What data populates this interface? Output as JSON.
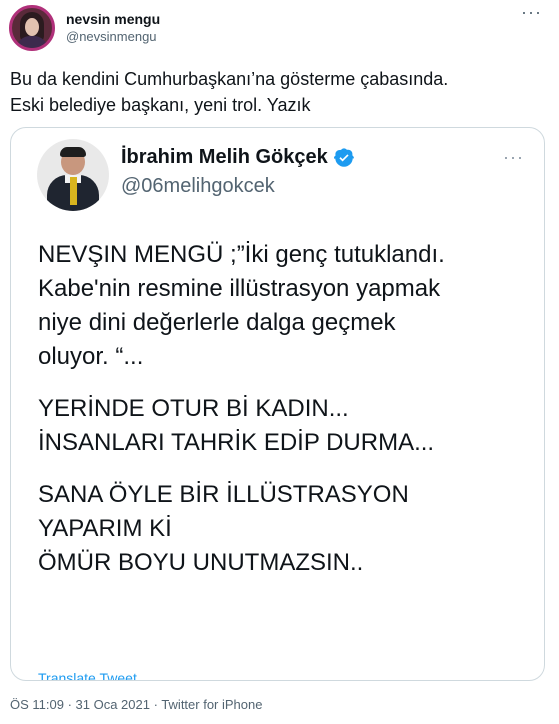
{
  "author": {
    "name": "nevsin mengu",
    "handle": "@nevsinmengu"
  },
  "more_glyph": "···",
  "tweet_text_lines": [
    "Bu da kendini Cumhurbaşkanı’na gösterme çabasında.",
    "Eski belediye başkanı, yeni trol. Yazık"
  ],
  "quoted": {
    "name": "İbrahim Melih Gökçek",
    "handle": "@06melihgokcek",
    "more_glyph": "···",
    "lines": [
      "NEVŞIN MENGÜ ;”İki genç tutuklandı.",
      "Kabe'nin resmine illüstrasyon yapmak",
      "niye dini değerlerle dalga geçmek",
      "oluyor. “...",
      "YERİNDE OTUR Bİ KADIN...",
      "İNSANLARI TAHRİK EDİP DURMA...",
      "SANA ÖYLE BİR İLLÜSTRASYON",
      "YAPARIM Kİ",
      "ÖMÜR BOYU UNUTMAZSIN.."
    ],
    "translate_label": "Translate Tweet"
  },
  "meta": {
    "time": "ÖS 11:09",
    "separator": " · ",
    "date": "31 Oca 2021",
    "source": "Twitter for iPhone"
  },
  "colors": {
    "link": "#1d9bf0",
    "secondary_text": "#536471",
    "border": "#cfd9de",
    "verified": "#1d9bf0"
  },
  "icons": {
    "verified": "verified-badge-icon",
    "more": "more-options-icon"
  }
}
